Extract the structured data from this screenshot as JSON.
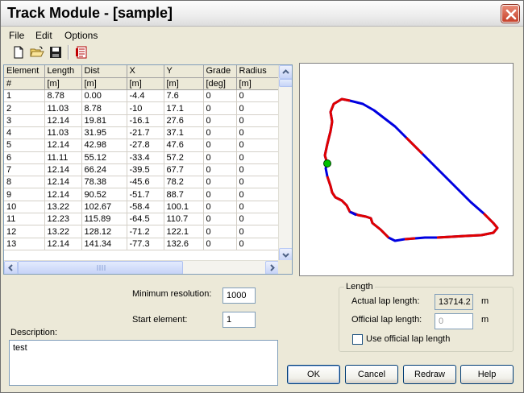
{
  "window": {
    "title": "Track Module - [sample]"
  },
  "menu": [
    "File",
    "Edit",
    "Options"
  ],
  "toolbar": {
    "icons": [
      "new-file-icon",
      "open-folder-icon",
      "save-disk-icon",
      "report-icon"
    ]
  },
  "table": {
    "headers": [
      "Element",
      "Length",
      "Dist",
      "X",
      "Y",
      "Grade",
      "Radius"
    ],
    "units": [
      "#",
      "[m]",
      "[m]",
      "[m]",
      "[m]",
      "[deg]",
      "[m]"
    ],
    "rows": [
      [
        "1",
        "8.78",
        "0.00",
        "-4.4",
        "7.6",
        "0",
        "0"
      ],
      [
        "2",
        "11.03",
        "8.78",
        "-10",
        "17.1",
        "0",
        "0"
      ],
      [
        "3",
        "12.14",
        "19.81",
        "-16.1",
        "27.6",
        "0",
        "0"
      ],
      [
        "4",
        "11.03",
        "31.95",
        "-21.7",
        "37.1",
        "0",
        "0"
      ],
      [
        "5",
        "12.14",
        "42.98",
        "-27.8",
        "47.6",
        "0",
        "0"
      ],
      [
        "6",
        "11.11",
        "55.12",
        "-33.4",
        "57.2",
        "0",
        "0"
      ],
      [
        "7",
        "12.14",
        "66.24",
        "-39.5",
        "67.7",
        "0",
        "0"
      ],
      [
        "8",
        "12.14",
        "78.38",
        "-45.6",
        "78.2",
        "0",
        "0"
      ],
      [
        "9",
        "12.14",
        "90.52",
        "-51.7",
        "88.7",
        "0",
        "0"
      ],
      [
        "10",
        "13.22",
        "102.67",
        "-58.4",
        "100.1",
        "0",
        "0"
      ],
      [
        "11",
        "12.23",
        "115.89",
        "-64.5",
        "110.7",
        "0",
        "0"
      ],
      [
        "12",
        "13.22",
        "128.12",
        "-71.2",
        "122.1",
        "0",
        "0"
      ],
      [
        "13",
        "12.14",
        "141.34",
        "-77.3",
        "132.6",
        "0",
        "0"
      ]
    ]
  },
  "settings": {
    "min_resolution_label": "Minimum resolution:",
    "min_resolution_value": "1000",
    "start_element_label": "Start element:",
    "start_element_value": "1",
    "description_label": "Description:",
    "description_value": "test"
  },
  "length_group": {
    "title": "Length",
    "actual_label": "Actual lap length:",
    "actual_value": "13714.2",
    "actual_unit": "m",
    "official_label": "Official lap length:",
    "official_value": "0",
    "official_unit": "m",
    "use_official_label": "Use official lap length",
    "use_official_checked": false
  },
  "buttons": {
    "ok": "OK",
    "cancel": "Cancel",
    "redraw": "Redraw",
    "help": "Help"
  },
  "colors": {
    "track_red": "#E00000",
    "track_blue": "#0000E0",
    "start_marker": "#00C000"
  }
}
